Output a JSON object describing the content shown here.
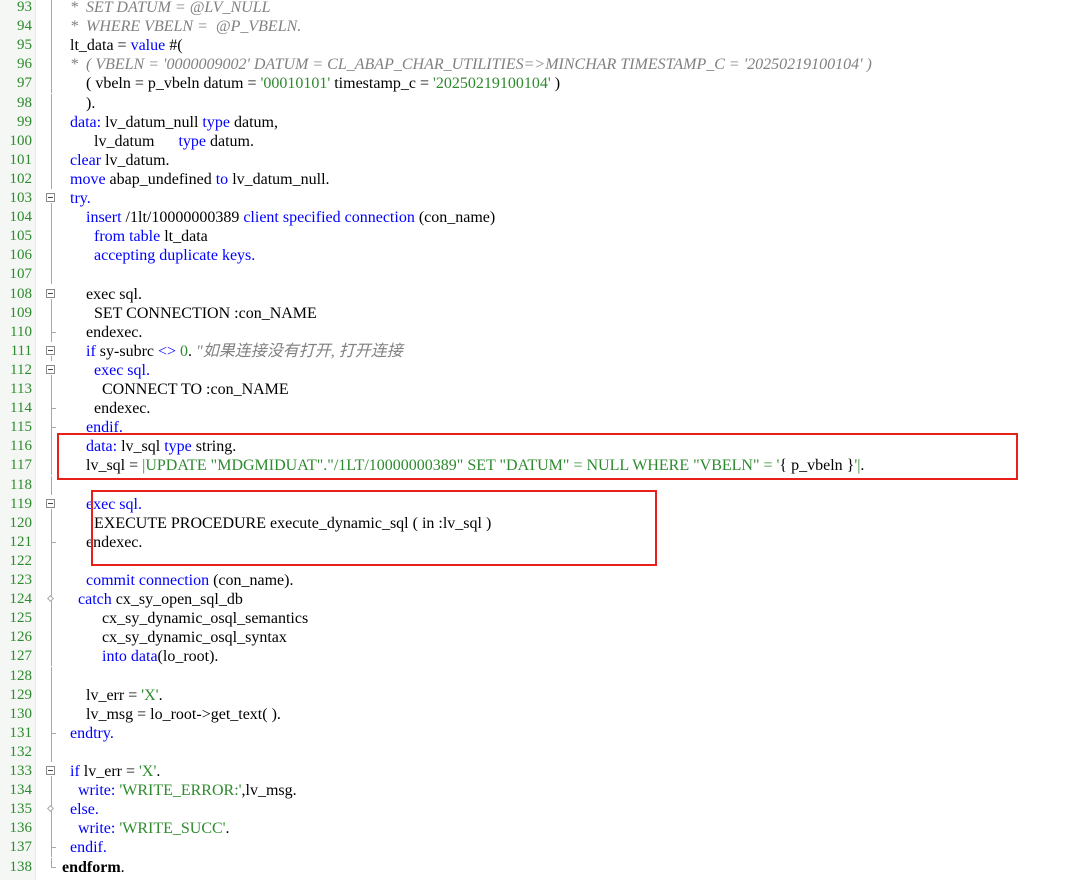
{
  "editor": {
    "highlight_color": "#e8201a",
    "lines": [
      {
        "n": "93",
        "fold": "line",
        "parts": [
          [
            "c",
            "  *  SET DATUM = @LV_NULL"
          ]
        ]
      },
      {
        "n": "94",
        "fold": "line",
        "parts": [
          [
            "c",
            "  *  WHERE VBELN =  @P_VBELN."
          ]
        ]
      },
      {
        "n": "95",
        "fold": "line",
        "parts": [
          [
            "t",
            "  lt_data = "
          ],
          [
            "k",
            "value"
          ],
          [
            "t",
            " #("
          ]
        ]
      },
      {
        "n": "96",
        "fold": "line",
        "parts": [
          [
            "c",
            "  *  ( VBELN = '0000009002' DATUM = CL_ABAP_CHAR_UTILITIES=>MINCHAR TIMESTAMP_C = '20250219100104' )"
          ]
        ]
      },
      {
        "n": "97",
        "fold": "line",
        "parts": [
          [
            "t",
            "      ( vbeln = p_vbeln datum = "
          ],
          [
            "s",
            "'00010101'"
          ],
          [
            "t",
            " timestamp_c = "
          ],
          [
            "s",
            "'20250219100104'"
          ],
          [
            "t",
            " )"
          ]
        ]
      },
      {
        "n": "98",
        "fold": "line",
        "parts": [
          [
            "t",
            "      )."
          ]
        ]
      },
      {
        "n": "99",
        "fold": "line",
        "parts": [
          [
            "k",
            "  data: "
          ],
          [
            "t",
            "lv_datum_null "
          ],
          [
            "k",
            "type"
          ],
          [
            "t",
            " datum,"
          ]
        ]
      },
      {
        "n": "100",
        "fold": "line",
        "parts": [
          [
            "t",
            "        lv_datum      "
          ],
          [
            "k",
            "type"
          ],
          [
            "t",
            " datum."
          ]
        ]
      },
      {
        "n": "101",
        "fold": "line",
        "parts": [
          [
            "k",
            "  clear"
          ],
          [
            "t",
            " lv_datum."
          ]
        ]
      },
      {
        "n": "102",
        "fold": "line",
        "parts": [
          [
            "k",
            "  move"
          ],
          [
            "t",
            " abap_undefined "
          ],
          [
            "k",
            "to"
          ],
          [
            "t",
            " lv_datum_null."
          ]
        ]
      },
      {
        "n": "103",
        "fold": "box",
        "parts": [
          [
            "k",
            "  try."
          ]
        ]
      },
      {
        "n": "104",
        "fold": "line",
        "parts": [
          [
            "k",
            "      insert"
          ],
          [
            "t",
            " /1lt/10000000389 "
          ],
          [
            "k",
            "client specified connection"
          ],
          [
            "t",
            " (con_name)"
          ]
        ]
      },
      {
        "n": "105",
        "fold": "line",
        "parts": [
          [
            "k",
            "        from table"
          ],
          [
            "t",
            " lt_data"
          ]
        ]
      },
      {
        "n": "106",
        "fold": "line",
        "parts": [
          [
            "k",
            "        accepting duplicate keys."
          ]
        ]
      },
      {
        "n": "107",
        "fold": "line",
        "parts": []
      },
      {
        "n": "108",
        "fold": "box",
        "parts": [
          [
            "t",
            "      exec sql."
          ]
        ]
      },
      {
        "n": "109",
        "fold": "line",
        "parts": [
          [
            "t",
            "        SET CONNECTION :con_NAME"
          ]
        ]
      },
      {
        "n": "110",
        "fold": "tick",
        "parts": [
          [
            "t",
            "      endexec."
          ]
        ]
      },
      {
        "n": "111",
        "fold": "box",
        "parts": [
          [
            "k",
            "      if"
          ],
          [
            "t",
            " sy-subrc "
          ],
          [
            "k",
            "<>"
          ],
          [
            "n",
            " 0"
          ],
          [
            "t",
            ". "
          ],
          [
            "c",
            "\"如果连接没有打开, 打开连接"
          ]
        ]
      },
      {
        "n": "112",
        "fold": "box",
        "parts": [
          [
            "k",
            "        exec sql."
          ]
        ]
      },
      {
        "n": "113",
        "fold": "line",
        "parts": [
          [
            "t",
            "          CONNECT TO :con_NAME"
          ]
        ]
      },
      {
        "n": "114",
        "fold": "tick",
        "parts": [
          [
            "t",
            "        endexec."
          ]
        ]
      },
      {
        "n": "115",
        "fold": "tick",
        "parts": [
          [
            "k",
            "      endif."
          ]
        ]
      },
      {
        "n": "116",
        "fold": "line",
        "parts": [
          [
            "k",
            "      data: "
          ],
          [
            "t",
            "lv_sql "
          ],
          [
            "k",
            "type"
          ],
          [
            "t",
            " string."
          ]
        ]
      },
      {
        "n": "117",
        "fold": "line",
        "parts": [
          [
            "t",
            "      lv_sql = "
          ],
          [
            "s",
            "|UPDATE \"MDGMIDUAT\".\"/1LT/10000000389\" SET \"DATUM\" = NULL WHERE \"VBELN\" = '"
          ],
          [
            "t",
            "{ p_vbeln }"
          ],
          [
            "s",
            "'|"
          ],
          [
            "t",
            "."
          ]
        ]
      },
      {
        "n": "118",
        "fold": "line",
        "parts": []
      },
      {
        "n": "119",
        "fold": "box",
        "parts": [
          [
            "k",
            "      exec sql."
          ]
        ]
      },
      {
        "n": "120",
        "fold": "line",
        "parts": [
          [
            "t",
            "        EXECUTE PROCEDURE execute_dynamic_sql ( in :lv_sql )"
          ]
        ]
      },
      {
        "n": "121",
        "fold": "tick",
        "parts": [
          [
            "t",
            "      endexec."
          ]
        ]
      },
      {
        "n": "122",
        "fold": "line",
        "parts": []
      },
      {
        "n": "123",
        "fold": "line",
        "parts": [
          [
            "k",
            "      commit connection"
          ],
          [
            "t",
            " (con_name)."
          ]
        ]
      },
      {
        "n": "124",
        "fold": "diamond",
        "parts": [
          [
            "k",
            "    catch"
          ],
          [
            "t",
            " cx_sy_open_sql_db"
          ]
        ]
      },
      {
        "n": "125",
        "fold": "line",
        "parts": [
          [
            "t",
            "          cx_sy_dynamic_osql_semantics"
          ]
        ]
      },
      {
        "n": "126",
        "fold": "line",
        "parts": [
          [
            "t",
            "          cx_sy_dynamic_osql_syntax"
          ]
        ]
      },
      {
        "n": "127",
        "fold": "line",
        "parts": [
          [
            "k",
            "          into data"
          ],
          [
            "t",
            "(lo_root)."
          ]
        ]
      },
      {
        "n": "128",
        "fold": "line",
        "parts": []
      },
      {
        "n": "129",
        "fold": "line",
        "parts": [
          [
            "t",
            "      lv_err = "
          ],
          [
            "s",
            "'X'"
          ],
          [
            "t",
            "."
          ]
        ]
      },
      {
        "n": "130",
        "fold": "line",
        "parts": [
          [
            "t",
            "      lv_msg = lo_root->get_text( )."
          ]
        ]
      },
      {
        "n": "131",
        "fold": "tick",
        "parts": [
          [
            "k",
            "  endtry."
          ]
        ]
      },
      {
        "n": "132",
        "fold": "line",
        "parts": []
      },
      {
        "n": "133",
        "fold": "box",
        "parts": [
          [
            "k",
            "  if"
          ],
          [
            "t",
            " lv_err = "
          ],
          [
            "s",
            "'X'"
          ],
          [
            "t",
            "."
          ]
        ]
      },
      {
        "n": "134",
        "fold": "line",
        "parts": [
          [
            "k",
            "    write: "
          ],
          [
            "s",
            "'WRITE_ERROR:'"
          ],
          [
            "t",
            ",lv_msg."
          ]
        ]
      },
      {
        "n": "135",
        "fold": "diamond",
        "parts": [
          [
            "k",
            "  else."
          ]
        ]
      },
      {
        "n": "136",
        "fold": "line",
        "parts": [
          [
            "k",
            "    write: "
          ],
          [
            "s",
            "'WRITE_SUCC'"
          ],
          [
            "t",
            "."
          ]
        ]
      },
      {
        "n": "137",
        "fold": "tick",
        "parts": [
          [
            "k",
            "  endif."
          ]
        ]
      },
      {
        "n": "138",
        "fold": "end",
        "parts": [
          [
            "b",
            "endform"
          ],
          [
            "t",
            "."
          ]
        ]
      }
    ]
  }
}
